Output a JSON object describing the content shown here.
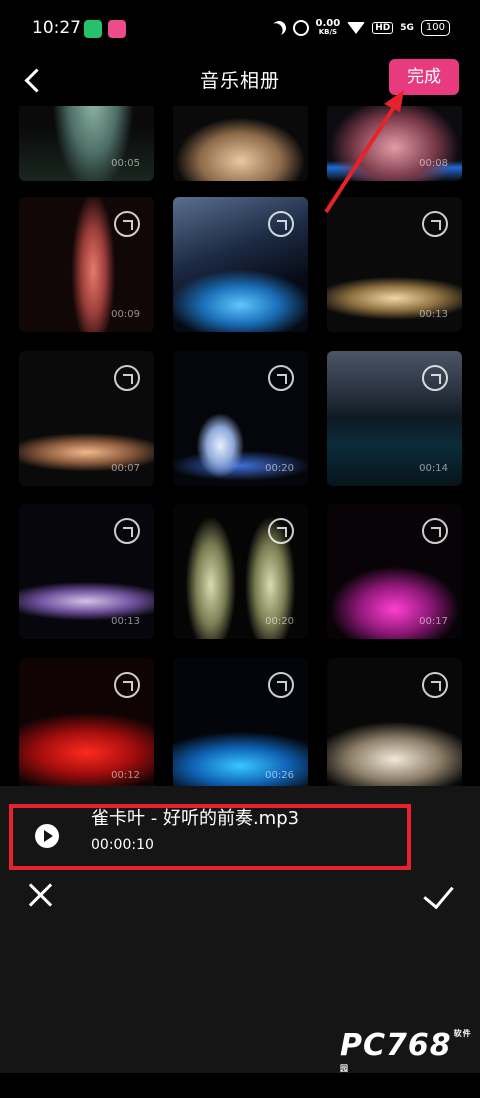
{
  "status": {
    "time": "10:27",
    "speed": "0.00",
    "speed_unit": "KB/S",
    "hd": "HD",
    "signal": "5G",
    "battery": "100"
  },
  "header": {
    "title": "音乐相册",
    "done": "完成"
  },
  "tiles": [
    {
      "dur": "00:05"
    },
    {
      "dur": ""
    },
    {
      "dur": "00:08"
    },
    {
      "dur": "00:09"
    },
    {
      "dur": ""
    },
    {
      "dur": "00:13"
    },
    {
      "dur": "00:07"
    },
    {
      "dur": "00:20"
    },
    {
      "dur": "00:14"
    },
    {
      "dur": "00:13"
    },
    {
      "dur": "00:20"
    },
    {
      "dur": "00:17"
    },
    {
      "dur": "00:12"
    },
    {
      "dur": "00:26"
    },
    {
      "dur": ""
    }
  ],
  "music": {
    "name": "雀卡叶 - 好听的前奏.mp3",
    "time": "00:00:10"
  },
  "watermark": {
    "brand": "PC768",
    "tag": "软件园"
  },
  "colors": {
    "accent": "#e83a7e",
    "highlight": "#e8222a"
  }
}
